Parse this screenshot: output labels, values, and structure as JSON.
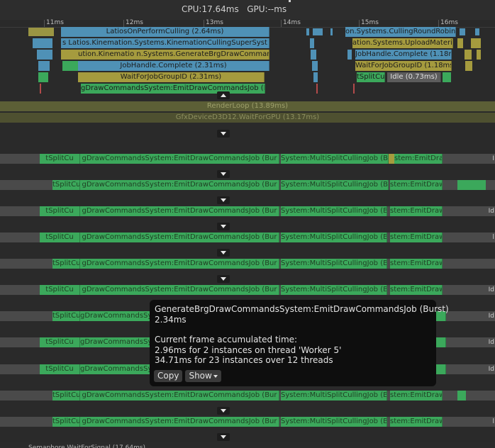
{
  "header": {
    "cpu_label": "CPU:17.64ms",
    "gpu_label": "GPU:--ms"
  },
  "ruler": {
    "ticks": [
      "11ms",
      "12ms",
      "13ms",
      "14ms",
      "15ms",
      "16ms"
    ]
  },
  "main_thread": {
    "bars": {
      "culling": "LatiosOnPerformCulling (2.64ms)",
      "culling_round": "on.Systems.CullingRoundRobinD",
      "culling_super": "s Latios.Kinemation.Systems.KinemationCullingSuperSyst",
      "upload": "ation.Systems.UploadMateria",
      "generate": "ation.Kinematio n.Systems.GenerateBrgDrawCommandsS",
      "generate_display": "ution.Kinematio n.Systems.GenerateBrgDrawCommandsS",
      "jobhandle_right": "JobHandle.Complete (1.18ms",
      "jobhandle": "JobHandle.Complete (2.31ms)",
      "wait_right": "WaitForJobGroupID (1.18ms",
      "wait": "WaitForJobGroupID (2.31ms)",
      "split_small": "tSplitCul",
      "idle": "Idle (0.73ms)",
      "emit": "gDrawCommandsSystem:EmitDrawCommandsJob (Burs"
    }
  },
  "render_thread": {
    "render_loop": "RenderLoop (13.89ms)",
    "gfx_wait": "GfxDeviceD3D12.WaitForGPU (13.17ms)"
  },
  "worker_labels": {
    "split": "tSplitCu",
    "emit": "gDrawCommandsSystem:EmitDrawCommandsJob (Bur",
    "multisplit": "System:MultiSplitCullingJob (Bur",
    "emit_right": "stem:EmitDraw",
    "idle_short": "Id",
    "idle_i": "I",
    "idle_l": "l"
  },
  "tooltip": {
    "title": "GenerateBrgDrawCommandsSystem:EmitDrawCommandsJob (Burst)",
    "duration": "2.34ms",
    "accum_label": "Current frame accumulated time:",
    "thread_line": "2.96ms for 2 instances on thread 'Worker 5'",
    "total_line": "34.71ms for 23 instances over 12 threads",
    "copy_label": "Copy",
    "show_label": "Show"
  },
  "footer": {
    "label": "Semaphore.WaitForSignal (17.64ms)"
  },
  "colors": {
    "worker_green": "#3ba85b",
    "main_blue": "#4f91b6",
    "main_olive": "#a59b3e",
    "render_olive": "#5c5f36"
  }
}
